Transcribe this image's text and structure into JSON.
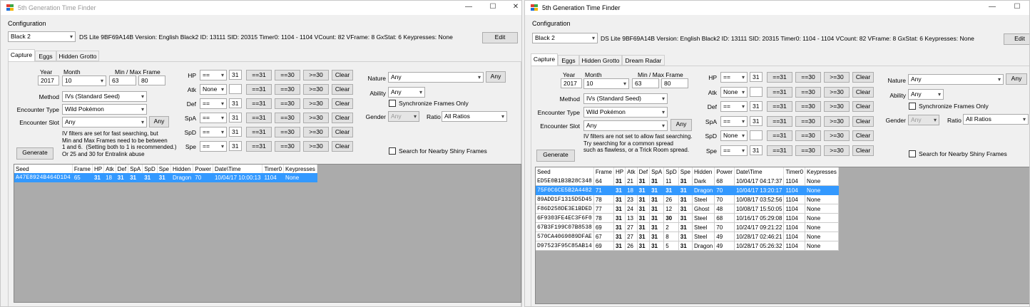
{
  "left": {
    "title": "5th Generation Time Finder",
    "config_label": "Configuration",
    "version": "Black 2",
    "profile_info": "DS Lite 9BF69A14B Version: English Black2 ID: 13111 SID: 20315 Timer0: 1104 - 1104 VCount: 82 VFrame: 8 GxStat: 6 Keypresses: None",
    "edit_label": "Edit",
    "tabs": [
      "Capture",
      "Eggs",
      "Hidden Grotto"
    ],
    "year_label": "Year",
    "year": "2017",
    "month_label": "Month",
    "month": "10",
    "frame_label": "Min / Max Frame",
    "min_frame": "63",
    "max_frame": "80",
    "method_label": "Method",
    "method": "IVs (Standard Seed)",
    "enc_type_label": "Encounter Type",
    "enc_type": "Wild Pokémon",
    "enc_slot_label": "Encounter Slot",
    "enc_slot": "Any",
    "any_label": "Any",
    "note": "IV filters are set for fast searching, but\nMin and Max Frames need to be between\n1 and 6.  (Setting both to 1 is recommended.)\nOr 25 and 30 for Entralink abuse",
    "generate_label": "Generate",
    "stats": [
      {
        "label": "HP",
        "op": "==",
        "val": "31"
      },
      {
        "label": "Atk",
        "op": "None",
        "val": ""
      },
      {
        "label": "Def",
        "op": "==",
        "val": "31"
      },
      {
        "label": "SpA",
        "op": "==",
        "val": "31"
      },
      {
        "label": "SpD",
        "op": "==",
        "val": "31"
      },
      {
        "label": "Spe",
        "op": "==",
        "val": "31"
      }
    ],
    "quick": {
      "eq31": "==31",
      "eq30": "==30",
      "ge30": ">=30",
      "clear": "Clear"
    },
    "nature_label": "Nature",
    "nature": "Any",
    "nature_any": "Any",
    "ability_label": "Ability",
    "ability": "Any",
    "sync_label": "Synchronize Frames Only",
    "gender_label": "Gender",
    "gender": "Any",
    "ratio_label": "Ratio",
    "ratio": "All Ratios",
    "shiny_label": "Search for Nearby Shiny Frames",
    "columns": [
      "Seed",
      "Frame",
      "HP",
      "Atk",
      "Def",
      "SpA",
      "SpD",
      "Spe",
      "Hidden",
      "Power",
      "Date\\Time",
      "Timer0",
      "Keypresses"
    ],
    "rows": [
      [
        "A47E8924B464D1D4",
        "65",
        "31",
        "18",
        "31",
        "31",
        "31",
        "31",
        "Dragon",
        "70",
        "10/04/17 10:00:13",
        "1104",
        "None"
      ]
    ]
  },
  "right": {
    "title": "5th Generation Time Finder",
    "config_label": "Configuration",
    "version": "Black 2",
    "profile_info": "DS Lite 9BF69A14B Version: English Black2 ID: 13111 SID: 20315 Timer0: 1104 - 1104 VCount: 82 VFrame: 8 GxStat: 6 Keypresses: None",
    "edit_label": "Edit",
    "tabs": [
      "Capture",
      "Eggs",
      "Hidden Grotto",
      "Dream Radar"
    ],
    "year_label": "Year",
    "year": "2017",
    "month_label": "Month",
    "month": "10",
    "frame_label": "Min / Max Frame",
    "min_frame": "63",
    "max_frame": "80",
    "method_label": "Method",
    "method": "IVs (Standard Seed)",
    "enc_type_label": "Encounter Type",
    "enc_type": "Wild Pokémon",
    "enc_slot_label": "Encounter Slot",
    "enc_slot": "Any",
    "any_label": "Any",
    "note": "IV filters are not set to allow fast searching.\nTry searching for a common spread\nsuch as flawless, or a Trick Room spread.",
    "generate_label": "Generate",
    "stats": [
      {
        "label": "HP",
        "op": "==",
        "val": "31"
      },
      {
        "label": "Atk",
        "op": "None",
        "val": ""
      },
      {
        "label": "Def",
        "op": "==",
        "val": "31"
      },
      {
        "label": "SpA",
        "op": "==",
        "val": "31"
      },
      {
        "label": "SpD",
        "op": "None",
        "val": ""
      },
      {
        "label": "Spe",
        "op": "==",
        "val": "31"
      }
    ],
    "quick": {
      "eq31": "==31",
      "eq30": "==30",
      "ge30": ">=30",
      "clear": "Clear"
    },
    "nature_label": "Nature",
    "nature": "Any",
    "nature_any": "Any",
    "ability_label": "Ability",
    "ability": "Any",
    "sync_label": "Synchronize Frames Only",
    "gender_label": "Gender",
    "gender": "Any",
    "ratio_label": "Ratio",
    "ratio": "All Ratios",
    "shiny_label": "Search for Nearby Shiny Frames",
    "columns": [
      "Seed",
      "Frame",
      "HP",
      "Atk",
      "Def",
      "SpA",
      "SpD",
      "Spe",
      "Hidden",
      "Power",
      "Date\\Time",
      "Timer0",
      "Keypresses"
    ],
    "rows": [
      [
        "ED5E0B1B3B28C348",
        "64",
        "31",
        "21",
        "31",
        "11",
        "31",
        "Dark",
        "68",
        "10/04/17 04:17:37",
        "1104",
        "None"
      ],
      [
        "75F0C6CE5B2A4482",
        "71",
        "31",
        "18",
        "31",
        "31",
        "31",
        "Dragon",
        "70",
        "10/04/17 13:20:17",
        "1104",
        "None"
      ],
      [
        "89ADD1F1315D5D45",
        "78",
        "31",
        "23",
        "31",
        "26",
        "31",
        "Steel",
        "70",
        "10/08/17 03:52:56",
        "1104",
        "None"
      ],
      [
        "F86D258DE3E1BDED",
        "77",
        "31",
        "24",
        "31",
        "12",
        "31",
        "Ghost",
        "48",
        "10/08/17 15:50:05",
        "1104",
        "None"
      ],
      [
        "6F9303FE4EC3F6F0",
        "78",
        "31",
        "13",
        "31",
        "30",
        "31",
        "Steel",
        "68",
        "10/16/17 05:29:08",
        "1104",
        "None"
      ],
      [
        "67B3F199C07B8538",
        "69",
        "31",
        "27",
        "31",
        "2",
        "31",
        "Steel",
        "70",
        "10/24/17 09:21:22",
        "1104",
        "None"
      ],
      [
        "570CA4069089DFAE",
        "67",
        "31",
        "27",
        "31",
        "8",
        "31",
        "Steel",
        "49",
        "10/28/17 02:46:21",
        "1104",
        "None"
      ],
      [
        "D97523F95C85AB14",
        "69",
        "31",
        "26",
        "31",
        "5",
        "31",
        "Dragon",
        "49",
        "10/28/17 05:26:32",
        "1104",
        "None"
      ]
    ],
    "row_ivs_extra": [
      {
        "spa": "31"
      },
      {
        "spa": "31"
      },
      {
        "spa": "31"
      },
      {
        "spa": "31"
      },
      {
        "spa": "31"
      },
      {
        "spa": "31"
      },
      {
        "spa": "31"
      },
      {
        "spa": "31"
      }
    ]
  },
  "window_controls": {
    "minimize": "—",
    "maximize": "☐",
    "close": "✕"
  },
  "icons": {
    "app": "app-icon",
    "dropdown": "chevron-down-icon"
  }
}
